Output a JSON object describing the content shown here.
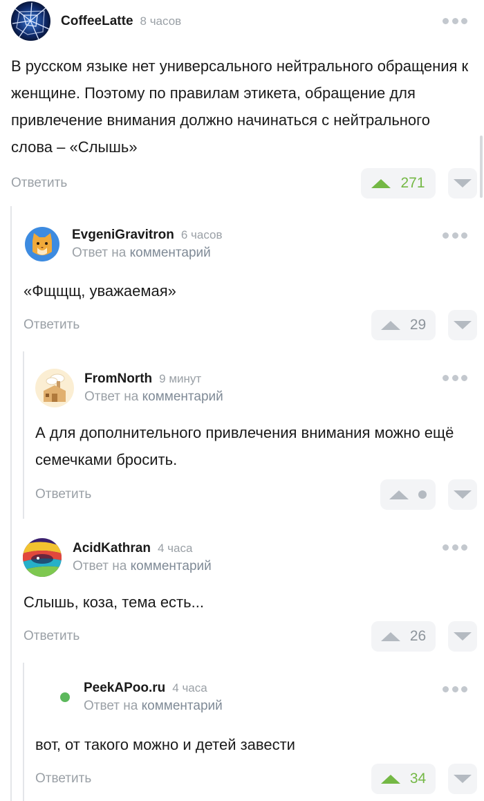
{
  "comments": [
    {
      "username": "CoffeeLatte",
      "time": "8 часов",
      "reply_to_prefix": "",
      "reply_to_link": "",
      "text": "В русском языке нет универсального нейтрального обращения к женщине. Поэтому по правилам этикета, обращение для привлечение внимания должно начинаться с нейтрального слова – «Слышь»",
      "reply_label": "Ответить",
      "score": "271",
      "score_color": "#74b845",
      "avatar_icon": "cracked-glass-avatar"
    },
    {
      "username": "EvgeniGravitron",
      "time": "6 часов",
      "reply_to_prefix": "Ответ на",
      "reply_to_link": "комментарий",
      "text": "«Фщщщ, уважаемая»",
      "reply_label": "Ответить",
      "score": "29",
      "score_color": "#8d949b",
      "avatar_icon": "cat-avatar"
    },
    {
      "username": "FromNorth",
      "time": "9 минут",
      "reply_to_prefix": "Ответ на",
      "reply_to_link": "комментарий",
      "text": "А для дополнительного привлечения внимания можно ещё семечками бросить.",
      "reply_label": "Ответить",
      "score": "",
      "score_color": "#b4bac1",
      "avatar_icon": "house-avatar"
    },
    {
      "username": "AcidKathran",
      "time": "4 часа",
      "reply_to_prefix": "Ответ на",
      "reply_to_link": "комментарий",
      "text": "Слышь, коза, тема есть...",
      "reply_label": "Ответить",
      "score": "26",
      "score_color": "#8d949b",
      "avatar_icon": "psychedelic-avatar"
    },
    {
      "username": "PeekAPoo.ru",
      "time": "4 часа",
      "reply_to_prefix": "Ответ на",
      "reply_to_link": "комментарий",
      "text": "вот, от такого можно и детей завести",
      "reply_label": "Ответить",
      "score": "34",
      "score_color": "#74b845",
      "avatar_icon": "online-status-dot"
    }
  ],
  "colors": {
    "accent_green": "#74b845",
    "muted_text": "#9aa0a6",
    "thread_line": "#e4e6e9",
    "vote_bg": "#f3f4f6"
  }
}
